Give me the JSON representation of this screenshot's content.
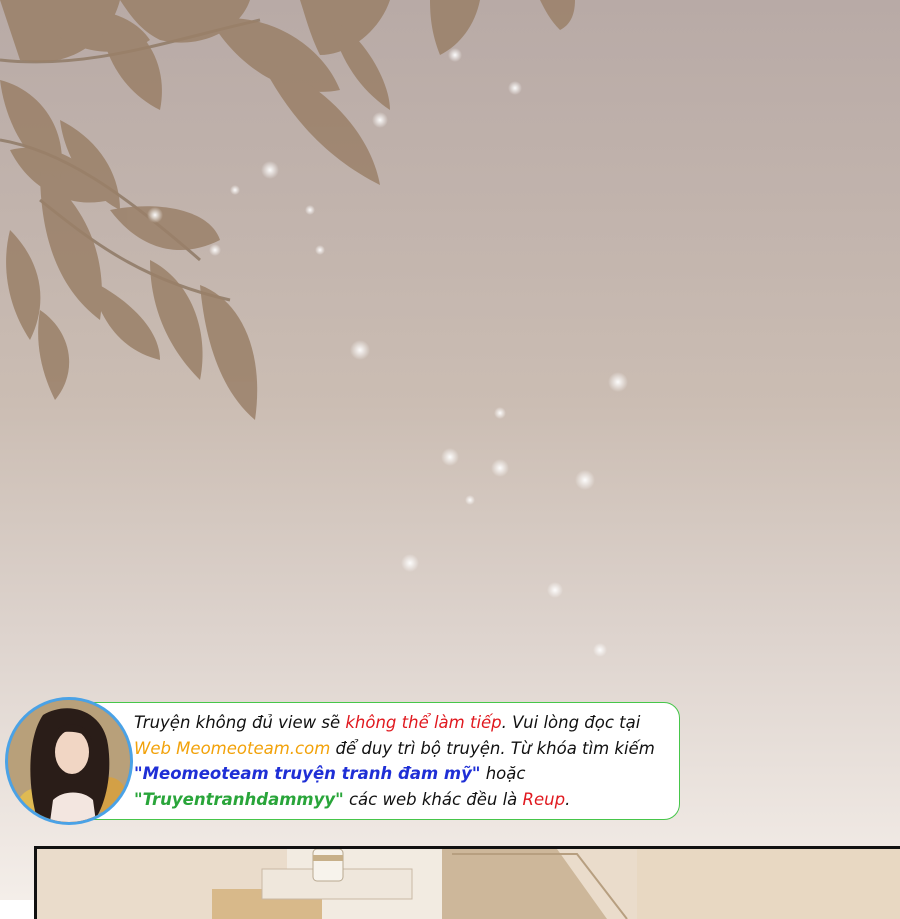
{
  "watermark": {
    "text": ""
  },
  "notice": {
    "line1": {
      "a": "Truyện không đủ view sẽ ",
      "b": "không thể làm tiếp",
      "c": ". Vui lòng đọc tại"
    },
    "line2": {
      "a": "Web Meomeoteam.com",
      "b": " để duy trì bộ truyện. Từ khóa tìm kiếm"
    },
    "line3": {
      "a": "\"Meomeoteam truyện tranh đam mỹ\"",
      "b": " hoặc"
    },
    "line4": {
      "a": "\"Truyentranhdammyy\"",
      "b": " các web khác đều là ",
      "c": "Reup",
      "d": "."
    }
  },
  "colors": {
    "red": "#e0191f",
    "orange": "#f2a20a",
    "blue": "#1f2fd6",
    "green": "#29a53a",
    "border": "#46c64a",
    "avatar_ring": "#4aa2e6"
  }
}
